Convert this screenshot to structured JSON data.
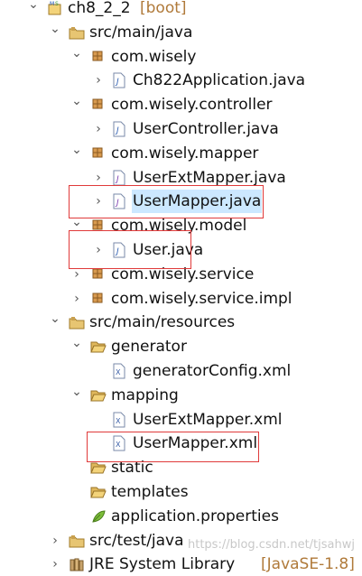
{
  "tree": [
    {
      "label": "ch8_2_2",
      "suffix": "[boot]",
      "icon": "project-icon",
      "toggle": "expanded",
      "level": 0
    },
    {
      "label": "src/main/java",
      "icon": "source-folder-icon",
      "toggle": "expanded",
      "level": 1
    },
    {
      "label": "com.wisely",
      "icon": "package-icon",
      "toggle": "expanded",
      "level": 2
    },
    {
      "label": "Ch822Application.java",
      "icon": "java-file-icon",
      "toggle": "collapsed",
      "level": 3
    },
    {
      "label": "com.wisely.controller",
      "icon": "package-icon",
      "toggle": "expanded",
      "level": 2
    },
    {
      "label": "UserController.java",
      "icon": "java-file-icon",
      "toggle": "collapsed",
      "level": 3
    },
    {
      "label": "com.wisely.mapper",
      "icon": "package-icon",
      "toggle": "expanded",
      "level": 2
    },
    {
      "label": "UserExtMapper.java",
      "icon": "java-interface-icon",
      "toggle": "collapsed",
      "level": 3
    },
    {
      "label": "UserMapper.java",
      "icon": "java-interface-icon",
      "toggle": "collapsed",
      "level": 3,
      "selected": true
    },
    {
      "label": "com.wisely.model",
      "icon": "package-icon",
      "toggle": "expanded",
      "level": 2
    },
    {
      "label": "User.java",
      "icon": "java-file-icon",
      "toggle": "collapsed",
      "level": 3
    },
    {
      "label": "com.wisely.service",
      "icon": "package-icon",
      "toggle": "collapsed",
      "level": 2
    },
    {
      "label": "com.wisely.service.impl",
      "icon": "package-icon",
      "toggle": "collapsed",
      "level": 2
    },
    {
      "label": "src/main/resources",
      "icon": "source-folder-icon",
      "toggle": "expanded",
      "level": 1
    },
    {
      "label": "generator",
      "icon": "folder-open-icon",
      "toggle": "expanded",
      "level": 2
    },
    {
      "label": "generatorConfig.xml",
      "icon": "xml-file-icon",
      "toggle": "none",
      "level": 3
    },
    {
      "label": "mapping",
      "icon": "folder-open-icon",
      "toggle": "expanded",
      "level": 2
    },
    {
      "label": "UserExtMapper.xml",
      "icon": "xml-file-icon",
      "toggle": "none",
      "level": 3
    },
    {
      "label": "UserMapper.xml",
      "icon": "xml-file-icon",
      "toggle": "none",
      "level": 3
    },
    {
      "label": "static",
      "icon": "folder-open-icon",
      "toggle": "none",
      "level": 2
    },
    {
      "label": "templates",
      "icon": "folder-open-icon",
      "toggle": "none",
      "level": 2
    },
    {
      "label": "application.properties",
      "icon": "properties-file-icon",
      "toggle": "none",
      "level": 2
    },
    {
      "label": "src/test/java",
      "icon": "source-folder-icon",
      "toggle": "collapsed",
      "level": 1
    },
    {
      "label": "JRE System Library",
      "suffix": "[JavaSE-1.8]",
      "icon": "library-icon",
      "toggle": "collapsed",
      "level": 1
    }
  ],
  "watermark": "https://blog.csdn.net/tjsahwj",
  "colors": {
    "selection": "#cce8ff",
    "highlight_box": "#e03a3a",
    "decoration": "#b07a3a"
  }
}
